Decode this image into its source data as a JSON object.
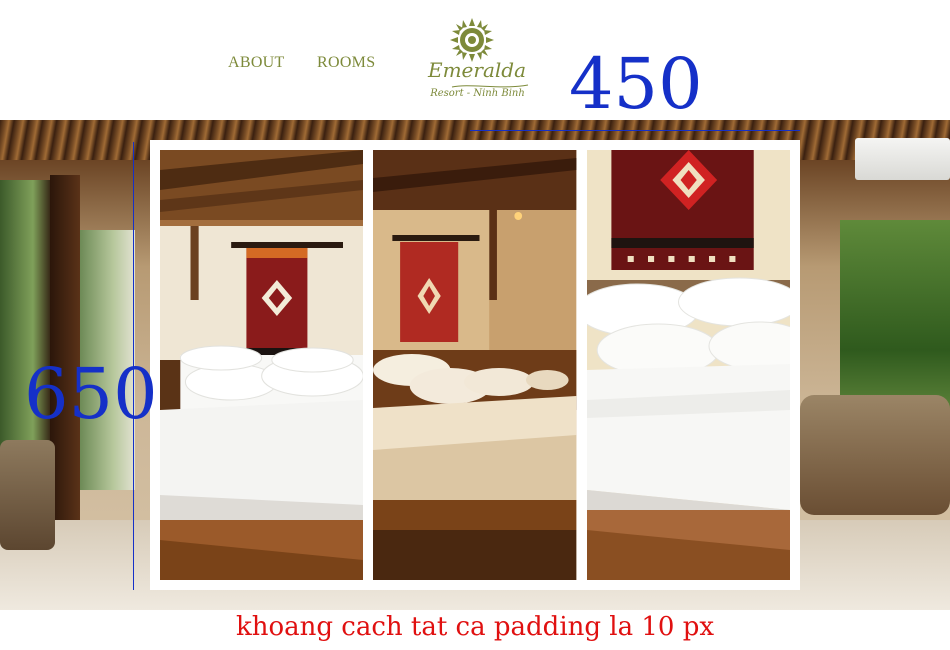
{
  "nav": {
    "items": [
      {
        "label": "ABOUT"
      },
      {
        "label": "ROOMS"
      }
    ]
  },
  "logo": {
    "name": "Emeralda",
    "tagline": "Resort - Ninh Binh",
    "icon": "sun-flower-icon",
    "color": "#7d8a3a"
  },
  "annotations": {
    "width_value": "450",
    "height_value": "650",
    "color": "#1530c8"
  },
  "gallery": {
    "photos": [
      {
        "icon": "bedroom-photo-1"
      },
      {
        "icon": "bedroom-photo-2"
      },
      {
        "icon": "bedroom-photo-3"
      }
    ]
  },
  "caption": {
    "text": "khoang cach tat ca padding la 10 px",
    "color": "#e01010"
  }
}
